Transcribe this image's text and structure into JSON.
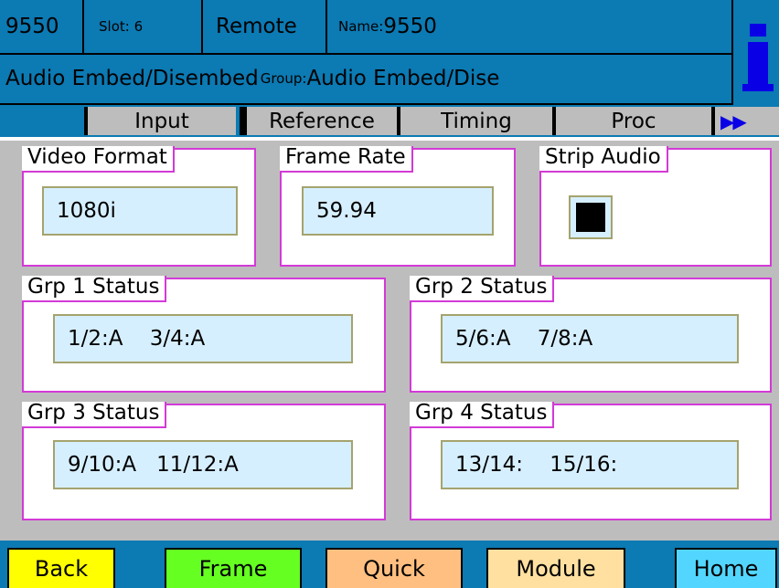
{
  "header": {
    "device": "9550",
    "slot": "Slot: 6",
    "mode": "Remote",
    "name_label": "Name:",
    "name_value": "9550",
    "card_type": "Audio Embed/Disembed",
    "group_label": "Group:",
    "group_value": "Audio Embed/Dise"
  },
  "tabs": [
    {
      "label": "Input"
    },
    {
      "label": "Reference"
    },
    {
      "label": "Timing"
    },
    {
      "label": "Proc"
    }
  ],
  "tabs_more_icon": "double-right-arrow-icon",
  "info_icon": "info-icon",
  "panels": {
    "video_format": {
      "title": "Video Format",
      "value": "1080i"
    },
    "frame_rate": {
      "title": "Frame Rate",
      "value": "59.94"
    },
    "strip_audio": {
      "title": "Strip Audio",
      "checked": true
    },
    "grp1": {
      "title": "Grp 1 Status",
      "value": "1/2:A    3/4:A"
    },
    "grp2": {
      "title": "Grp 2 Status",
      "value": "5/6:A    7/8:A"
    },
    "grp3": {
      "title": "Grp 3 Status",
      "value": "9/10:A   11/12:A"
    },
    "grp4": {
      "title": "Grp 4 Status",
      "value": "13/14:    15/16:"
    }
  },
  "buttons": {
    "back": "Back",
    "frame": "Frame",
    "quick": "Quick",
    "module": "Module",
    "home": "Home"
  },
  "colors": {
    "header_bg": "#0c7ab3",
    "panel_border": "#d23ad6",
    "field_bg": "#d6efff",
    "back_btn": "#ffff00",
    "frame_btn": "#66ff22",
    "quick_btn": "#ffbf80",
    "module_btn": "#ffe0a0",
    "home_btn": "#52d6ff"
  }
}
